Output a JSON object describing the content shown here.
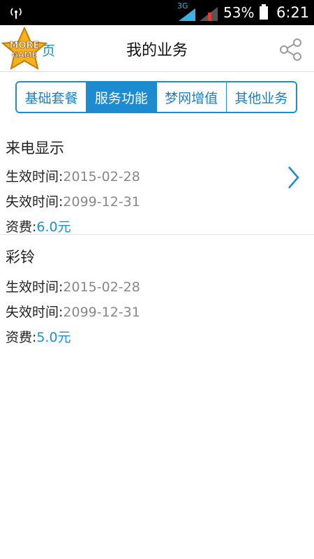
{
  "status_bar": {
    "network": "3G",
    "battery_percent": "53%",
    "time": "6:21"
  },
  "header": {
    "back_label": "页",
    "title": "我的业务",
    "badge_text_top": "MORE",
    "badge_text_bottom": "GAME"
  },
  "tabs": [
    {
      "label": "基础套餐",
      "active": false
    },
    {
      "label": "服务功能",
      "active": true
    },
    {
      "label": "梦网增值",
      "active": false
    },
    {
      "label": "其他业务",
      "active": false
    }
  ],
  "services": [
    {
      "name": "来电显示",
      "start_label": "生效时间:",
      "start_value": "2015-02-28",
      "end_label": "失效时间:",
      "end_value": "2099-12-31",
      "fee_label": "资费:",
      "fee_value": "6.0元"
    },
    {
      "name": "彩铃",
      "start_label": "生效时间:",
      "start_value": "2015-02-28",
      "end_label": "失效时间:",
      "end_value": "2099-12-31",
      "fee_label": "资费:",
      "fee_value": "5.0元"
    }
  ],
  "colors": {
    "accent": "#1c8bd0",
    "muted_text": "#888888",
    "status_bar": "#000000"
  }
}
